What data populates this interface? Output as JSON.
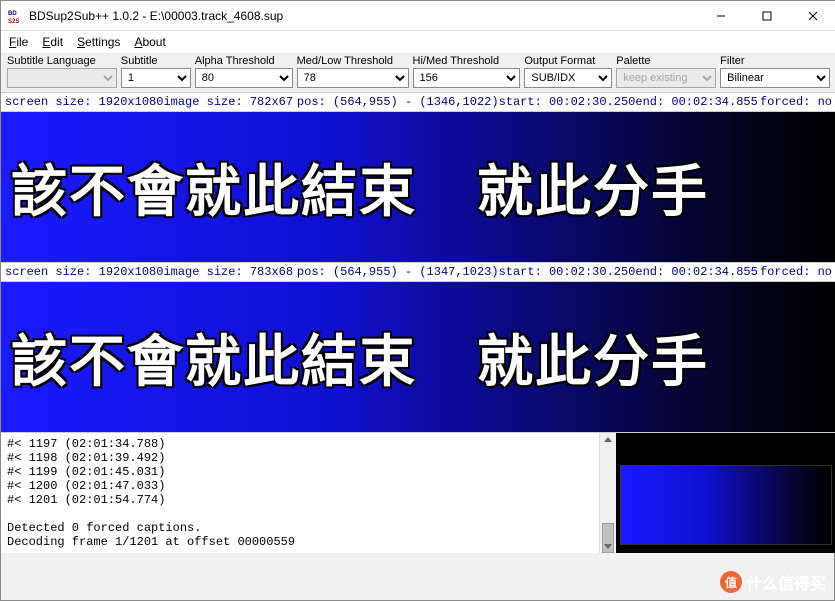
{
  "window": {
    "app_name": "BDSup2Sub++",
    "version": "1.0.2",
    "file": "E:\\00003.track_4608.sup",
    "title": "BDSup2Sub++ 1.0.2 - E:\\00003.track_4608.sup"
  },
  "menu": {
    "file": "File",
    "edit": "Edit",
    "settings": "Settings",
    "about": "About"
  },
  "toolbar": {
    "subtitle_language": {
      "label": "Subtitle Language",
      "value": ""
    },
    "subtitle": {
      "label": "Subtitle",
      "value": "1"
    },
    "alpha_threshold": {
      "label": "Alpha Threshold",
      "value": "80"
    },
    "medlow_threshold": {
      "label": "Med/Low Threshold",
      "value": "78"
    },
    "himed_threshold": {
      "label": "Hi/Med Threshold",
      "value": "156"
    },
    "output_format": {
      "label": "Output Format",
      "value": "SUB/IDX"
    },
    "palette": {
      "label": "Palette",
      "value": "keep existing"
    },
    "filter": {
      "label": "Filter",
      "value": "Bilinear"
    }
  },
  "info1": {
    "screen_size": "screen size: 1920x1080",
    "image_size": "image size: 782x67",
    "pos": "pos: (564,955) - (1346,1022)",
    "start": "start: 00:02:30.250",
    "end": "end: 00:02:34.855",
    "forced": "forced: no"
  },
  "info2": {
    "screen_size": "screen size: 1920x1080",
    "image_size": "image size: 783x68",
    "pos": "pos: (564,955) - (1347,1023)",
    "start": "start: 00:02:30.250",
    "end": "end: 00:02:34.855",
    "forced": "forced: no"
  },
  "subtitle_text": {
    "part1": "該不會就此結束",
    "part2": "就此分手"
  },
  "log": {
    "lines": [
      "#< 1197 (02:01:34.788)",
      "#< 1198 (02:01:39.492)",
      "#< 1199 (02:01:45.031)",
      "#< 1200 (02:01:47.033)",
      "#< 1201 (02:01:54.774)",
      "",
      "Detected 0 forced captions.",
      "Decoding frame 1/1201 at offset 00000559"
    ]
  },
  "watermark": {
    "badge": "值",
    "text": "什么值得买"
  }
}
